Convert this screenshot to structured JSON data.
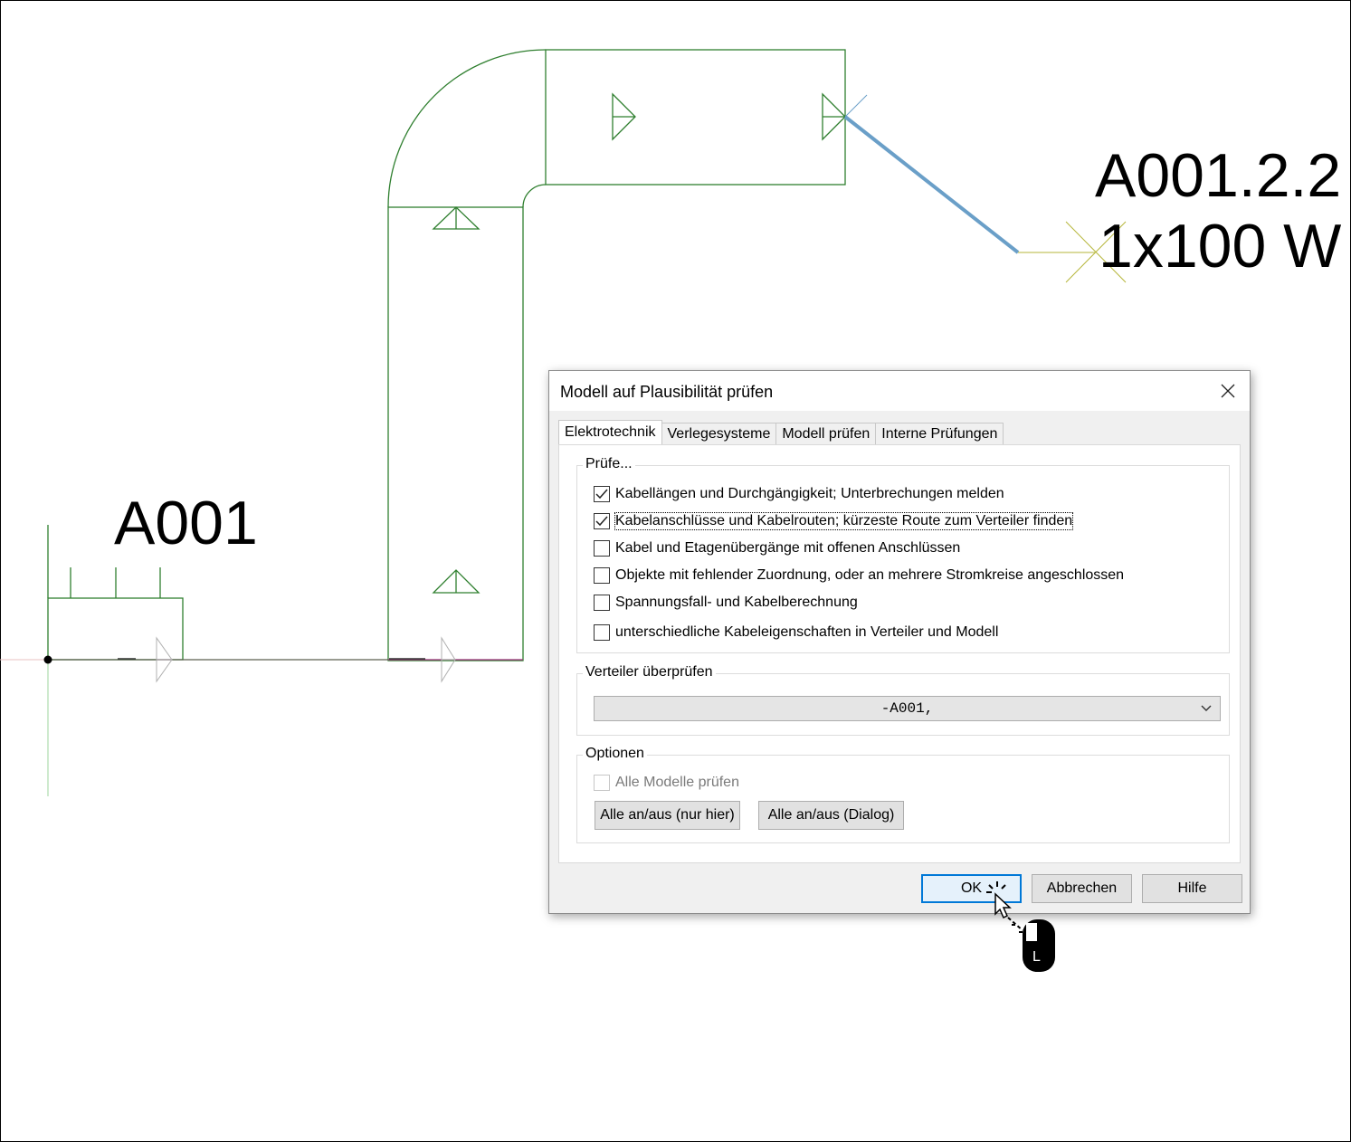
{
  "drawing": {
    "labels": {
      "distributor": "A001",
      "circuit": "A001.2.2",
      "load": "1x100 W"
    },
    "colors": {
      "cable_tray": "#2f7f2f",
      "cable_route": "#6a9fc8",
      "wire": "#a0307f",
      "fixture": "#b6b63a"
    }
  },
  "dialog": {
    "title": "Modell auf Plausibilität prüfen",
    "close_icon": "close-icon",
    "tabs": [
      {
        "label": "Elektrotechnik",
        "active": true
      },
      {
        "label": "Verlegesysteme",
        "active": false
      },
      {
        "label": "Modell prüfen",
        "active": false
      },
      {
        "label": "Interne Prüfungen",
        "active": false
      }
    ],
    "check_group": {
      "legend": "Prüfe...",
      "items": [
        {
          "label": "Kabellängen und Durchgängigkeit; Unterbrechungen melden",
          "checked": true
        },
        {
          "label": "Kabelanschlüsse und Kabelrouten; kürzeste Route zum Verteiler finden",
          "checked": true
        },
        {
          "label": "Kabel und Etagenübergänge mit offenen Anschlüssen",
          "checked": false
        },
        {
          "label": "Objekte mit fehlender Zuordnung, oder an mehrere Stromkreise angeschlossen",
          "checked": false
        },
        {
          "label": "Spannungsfall- und Kabelberechnung",
          "checked": false
        },
        {
          "label": "unterschiedliche Kabeleigenschaften in Verteiler und Modell",
          "checked": false
        }
      ]
    },
    "distributor_group": {
      "legend": "Verteiler überprüfen",
      "selected": "-A001,"
    },
    "options_group": {
      "legend": "Optionen",
      "all_models_label": "Alle Modelle prüfen",
      "all_models_checked": false,
      "toggle_here_label": "Alle an/aus (nur hier)",
      "toggle_dialog_label": "Alle an/aus (Dialog)"
    },
    "buttons": {
      "ok": "OK",
      "cancel": "Abbrechen",
      "help": "Hilfe"
    }
  },
  "cursor": {
    "icon": "mouse-left-click-icon",
    "button_letter": "L"
  }
}
